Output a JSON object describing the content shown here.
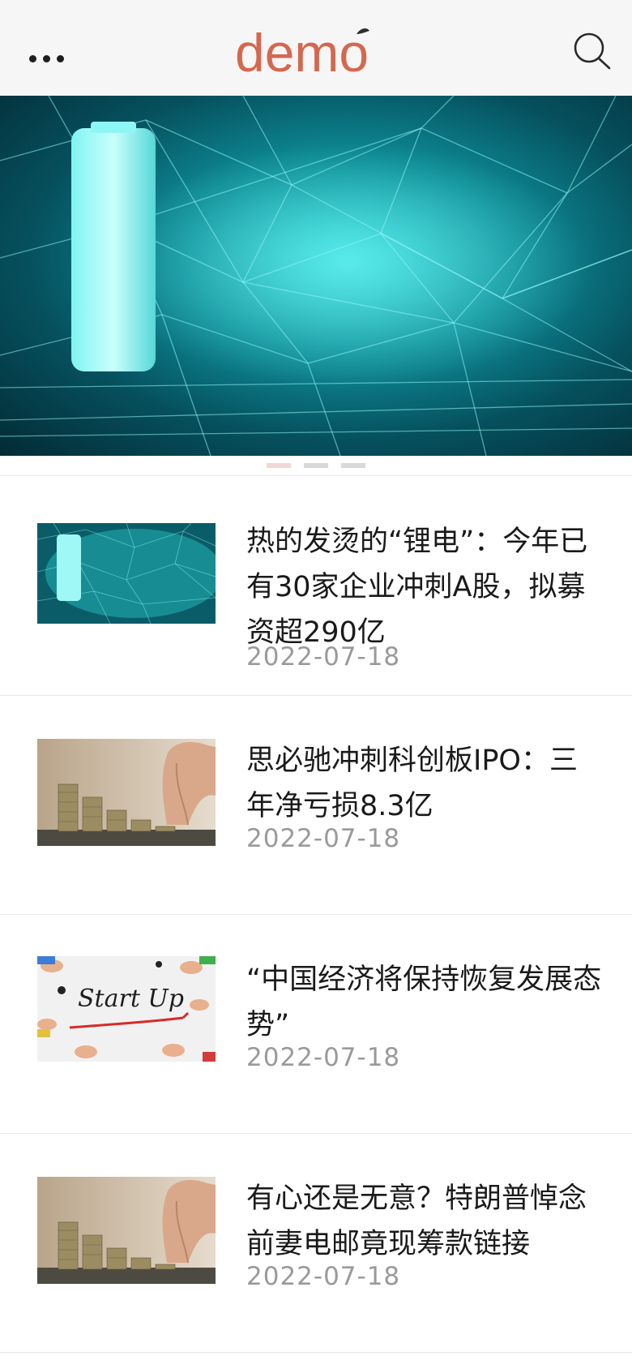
{
  "header": {
    "logo_text": "demo",
    "menu_icon": "more-dots-icon",
    "search_icon": "search-icon",
    "brand_color": "#d4684f"
  },
  "banner": {
    "image": "lithium-battery-network-image",
    "indicators": 3,
    "active_index": 0
  },
  "news": [
    {
      "title": "热的发烫的“锂电”：今年已有30家企业冲刺A股，拟募资超290亿",
      "date": "2022-07-18",
      "thumb": "battery-thumbnail"
    },
    {
      "title": "思必驰冲刺科创板IPO：三年净亏损8.3亿",
      "date": "2022-07-18",
      "thumb": "coins-stack-thumbnail"
    },
    {
      "title": "“中国经济将保持恢复发展态势”",
      "date": "2022-07-18",
      "thumb": "start-up-thumbnail",
      "image_text": "Start Up"
    },
    {
      "title": "有心还是无意？特朗普悼念前妻电邮竟现筹款链接",
      "date": "2022-07-18",
      "thumb": "coins-stack-thumbnail"
    }
  ]
}
